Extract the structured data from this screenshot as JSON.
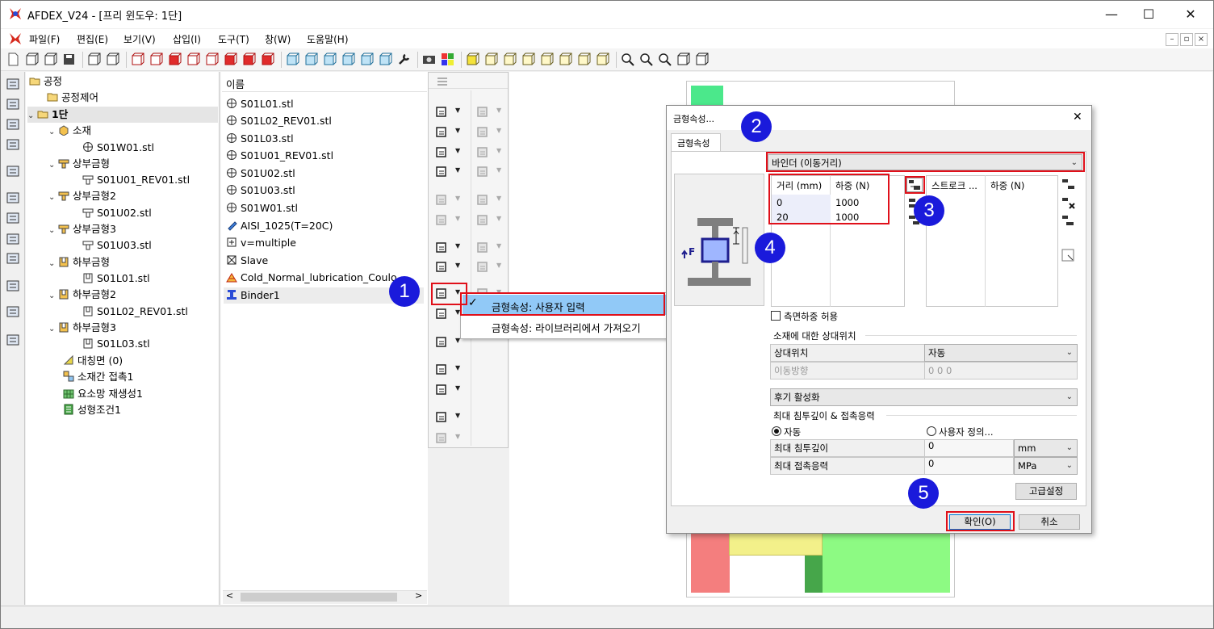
{
  "window": {
    "title": "AFDEX_V24 - [프리 윈도우: 1단]",
    "minimize": "—",
    "maximize": "☐",
    "close": "✕"
  },
  "menu": [
    "파일(F)",
    "편집(E)",
    "보기(V)",
    "삽입(I)",
    "도구(T)",
    "창(W)",
    "도움말(H)"
  ],
  "tree": {
    "root": "공정",
    "items": [
      {
        "label": "공정제어"
      },
      {
        "label": "1단"
      },
      {
        "label": "소재"
      },
      {
        "label": "S01W01.stl"
      },
      {
        "label": "상부금형"
      },
      {
        "label": "S01U01_REV01.stl"
      },
      {
        "label": "상부금형2"
      },
      {
        "label": "S01U02.stl"
      },
      {
        "label": "상부금형3"
      },
      {
        "label": "S01U03.stl"
      },
      {
        "label": "하부금형"
      },
      {
        "label": "S01L01.stl"
      },
      {
        "label": "하부금형2"
      },
      {
        "label": "S01L02_REV01.stl"
      },
      {
        "label": "하부금형3"
      },
      {
        "label": "S01L03.stl"
      },
      {
        "label": "대칭면 (0)"
      },
      {
        "label": "소재간 접촉1"
      },
      {
        "label": "요소망 재생성1"
      },
      {
        "label": "성형조건1"
      }
    ]
  },
  "list": {
    "header": "이름",
    "items": [
      {
        "label": "S01L01.stl"
      },
      {
        "label": "S01L02_REV01.stl"
      },
      {
        "label": "S01L03.stl"
      },
      {
        "label": "S01U01_REV01.stl"
      },
      {
        "label": "S01U02.stl"
      },
      {
        "label": "S01U03.stl"
      },
      {
        "label": "S01W01.stl"
      },
      {
        "label": "AISI_1025(T=20C)"
      },
      {
        "label": "v=multiple"
      },
      {
        "label": "Slave"
      },
      {
        "label": "Cold_Normal_lubrication_Coulo"
      },
      {
        "label": "Binder1"
      }
    ],
    "scroll_left": "<",
    "scroll_right": ">"
  },
  "context_menu": {
    "check": "✓",
    "item1": "금형속성: 사용자 입력",
    "item2": "금형속성: 라이브러리에서 가져오기"
  },
  "dialog": {
    "title": "금형속성...",
    "close": "✕",
    "tab": "금형속성",
    "type_select": "바인더 (이동거리)",
    "table1": {
      "col1": "거리 (mm)",
      "col2": "하중 (N)",
      "rows": [
        [
          "0",
          "1000"
        ],
        [
          "20",
          "1000"
        ]
      ]
    },
    "table2": {
      "col1": "스트로크 ...",
      "col2": "하중 (N)"
    },
    "diagram_label": "F",
    "side_load_checkbox": "측면하중 허용",
    "relative_section": "소재에 대한 상대위치",
    "relative_position_label": "상대위치",
    "relative_position_value": "자동",
    "move_direction_label": "이동방향",
    "move_direction_value": "0 0 0",
    "post_activation": "후기 활성화",
    "penetration_section": "최대 침투깊이 & 접촉응력",
    "radio_auto": "자동",
    "radio_user": "사용자 정의...",
    "max_depth_label": "최대 침투깊이",
    "max_depth_value": "0",
    "max_depth_unit": "mm",
    "max_stress_label": "최대 접촉응력",
    "max_stress_value": "0",
    "max_stress_unit": "MPa",
    "advanced_button": "고급설정",
    "ok_button": "확인(O)",
    "cancel_button": "취소"
  },
  "badges": [
    "1",
    "2",
    "3",
    "4",
    "5"
  ],
  "colors": {
    "highlight_red": "#e0101a",
    "badge_blue": "#1a1adb",
    "selected_menu": "#91c9f7"
  }
}
